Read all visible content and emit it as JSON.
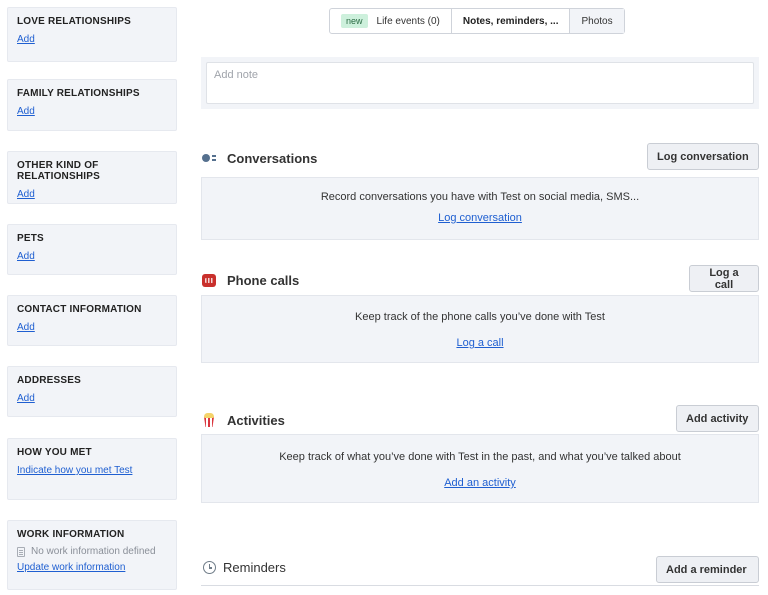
{
  "sidebar": {
    "love": {
      "title": "LOVE RELATIONSHIPS",
      "link": "Add"
    },
    "family": {
      "title": "FAMILY RELATIONSHIPS",
      "link": "Add"
    },
    "other": {
      "title": "OTHER KIND OF RELATIONSHIPS",
      "link": "Add"
    },
    "pets": {
      "title": "PETS",
      "link": "Add"
    },
    "contact": {
      "title": "CONTACT INFORMATION",
      "link": "Add"
    },
    "addresses": {
      "title": "ADDRESSES",
      "link": "Add"
    },
    "how_met": {
      "title": "HOW YOU MET",
      "link": "Indicate how you met Test"
    },
    "work": {
      "title": "WORK INFORMATION",
      "empty_text": "No work information defined",
      "link": "Update work information"
    }
  },
  "tabs": {
    "life_events": {
      "badge": "new",
      "label": "Life events (0)"
    },
    "notes": {
      "label": "Notes, reminders, ..."
    },
    "photos": {
      "label": "Photos"
    }
  },
  "note": {
    "placeholder": "Add note"
  },
  "conversations": {
    "title": "Conversations",
    "button": "Log conversation",
    "description": "Record conversations you have with Test on social media, SMS...",
    "link": "Log conversation",
    "icon": "speaking-head-icon"
  },
  "phone_calls": {
    "title": "Phone calls",
    "button": "Log a call",
    "description": "Keep track of the phone calls you’ve done with Test",
    "link": "Log a call",
    "icon": "telephone-icon"
  },
  "activities": {
    "title": "Activities",
    "button": "Add activity",
    "description": "Keep track of what you’ve done with Test in the past, and what you’ve talked about",
    "link": "Add an activity",
    "icon": "popcorn-icon"
  },
  "reminders": {
    "title": "Reminders",
    "button": "Add a reminder",
    "icon": "alarm-clock-icon"
  },
  "colors": {
    "link": "#1f5fd1",
    "panel": "#f2f4f8",
    "badge_bg": "#cdf0dc",
    "phone_icon": "#c9302c"
  }
}
